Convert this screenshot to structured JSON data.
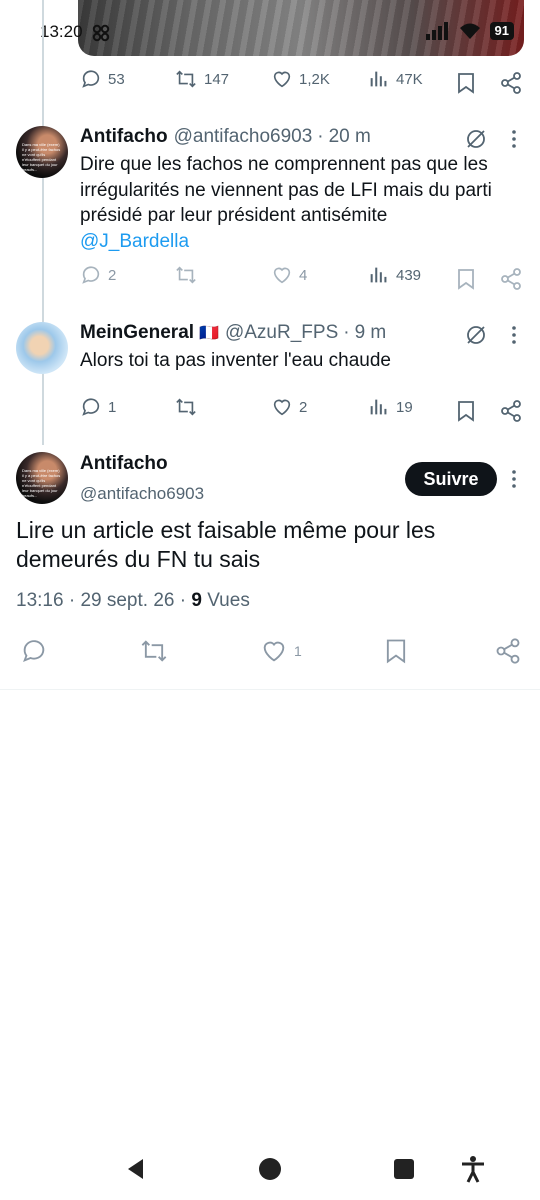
{
  "status_bar": {
    "time": "13:20",
    "battery": "91"
  },
  "prev_tweet_actions": {
    "replies": "53",
    "reposts": "147",
    "likes": "1,2K",
    "views": "47K"
  },
  "tweets": [
    {
      "name": "Antifacho",
      "handle": "@antifacho6903",
      "time": "20 m",
      "text": "Dire que les fachos ne comprennent pas que les irrégularités ne viennent pas de LFI mais du parti présidé par leur président antisémite",
      "mention": "@J_Bardella",
      "replies": "2",
      "likes": "4",
      "views": "439"
    },
    {
      "name": "MeinGeneral",
      "flag": "🇫🇷",
      "handle": "@AzuR_FPS",
      "time": "9 m",
      "text": "Alors toi ta pas inventer l'eau chaude",
      "replies": "1",
      "likes": "2",
      "views": "19"
    }
  ],
  "main_tweet": {
    "name": "Antifacho",
    "handle": "@antifacho6903",
    "follow_label": "Suivre",
    "text": "Lire un article est faisable même pour les demeurés du FN tu sais",
    "time": "13:16",
    "date": "29 sept. 26",
    "views_count": "9",
    "views_label": "Vues",
    "likes": "1"
  },
  "avatar_caption": "Dans ma ville (exem) il y a peut-être fachos ne vont qu'ils n'étouffent pendant leur banquet du jour beaufs...",
  "colors": {
    "accent": "#1d9bf0",
    "text": "#0f1419",
    "muted": "#536471"
  },
  "icons": [
    "reply-icon",
    "repost-icon",
    "like-icon",
    "views-icon",
    "bookmark-icon",
    "share-icon",
    "grok-icon",
    "more-icon",
    "back-icon",
    "home-icon",
    "recents-icon",
    "accessibility-icon"
  ]
}
